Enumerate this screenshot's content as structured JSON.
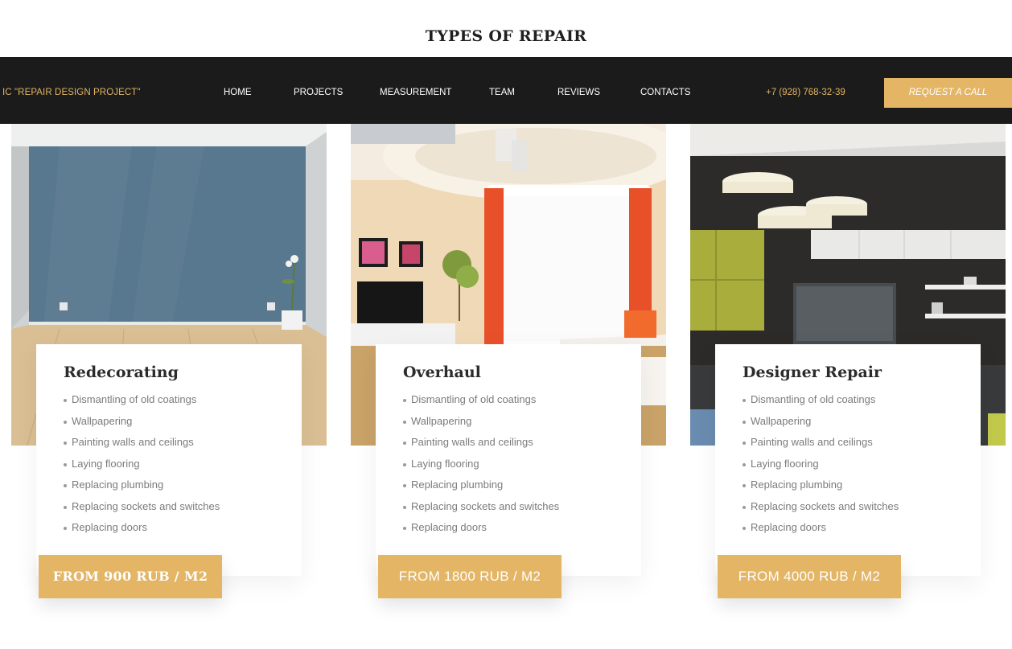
{
  "section_title": "TYPES OF REPAIR",
  "nav": {
    "brand": "IC \"REPAIR DESIGN PROJECT\"",
    "links": [
      "HOME",
      "PROJECTS",
      "MEASUREMENT",
      "TEAM",
      "REVIEWS",
      "CONTACTS"
    ],
    "phone": "+7 (928) 768-32-39",
    "cta": "REQUEST A CALL"
  },
  "colors": {
    "accent": "#e3b565",
    "navbar": "#1b1b1b"
  },
  "cards": [
    {
      "title": "Redecorating",
      "features": [
        "Dismantling of old coatings",
        "Wallpapering",
        "Painting walls and ceilings",
        "Laying flooring",
        "Replacing plumbing",
        "Replacing sockets and switches",
        "Replacing doors"
      ],
      "price": "FROM 900 RUB / M2"
    },
    {
      "title": "Overhaul",
      "features": [
        "Dismantling of old coatings",
        "Wallpapering",
        "Painting walls and ceilings",
        "Laying flooring",
        "Replacing plumbing",
        "Replacing sockets and switches",
        "Replacing doors"
      ],
      "price": "FROM 1800 RUB / M2"
    },
    {
      "title": "Designer Repair",
      "features": [
        "Dismantling of old coatings",
        "Wallpapering",
        "Painting walls and ceilings",
        "Laying flooring",
        "Replacing plumbing",
        "Replacing sockets and switches",
        "Replacing doors"
      ],
      "price": "FROM 4000 RUB / M2"
    }
  ]
}
